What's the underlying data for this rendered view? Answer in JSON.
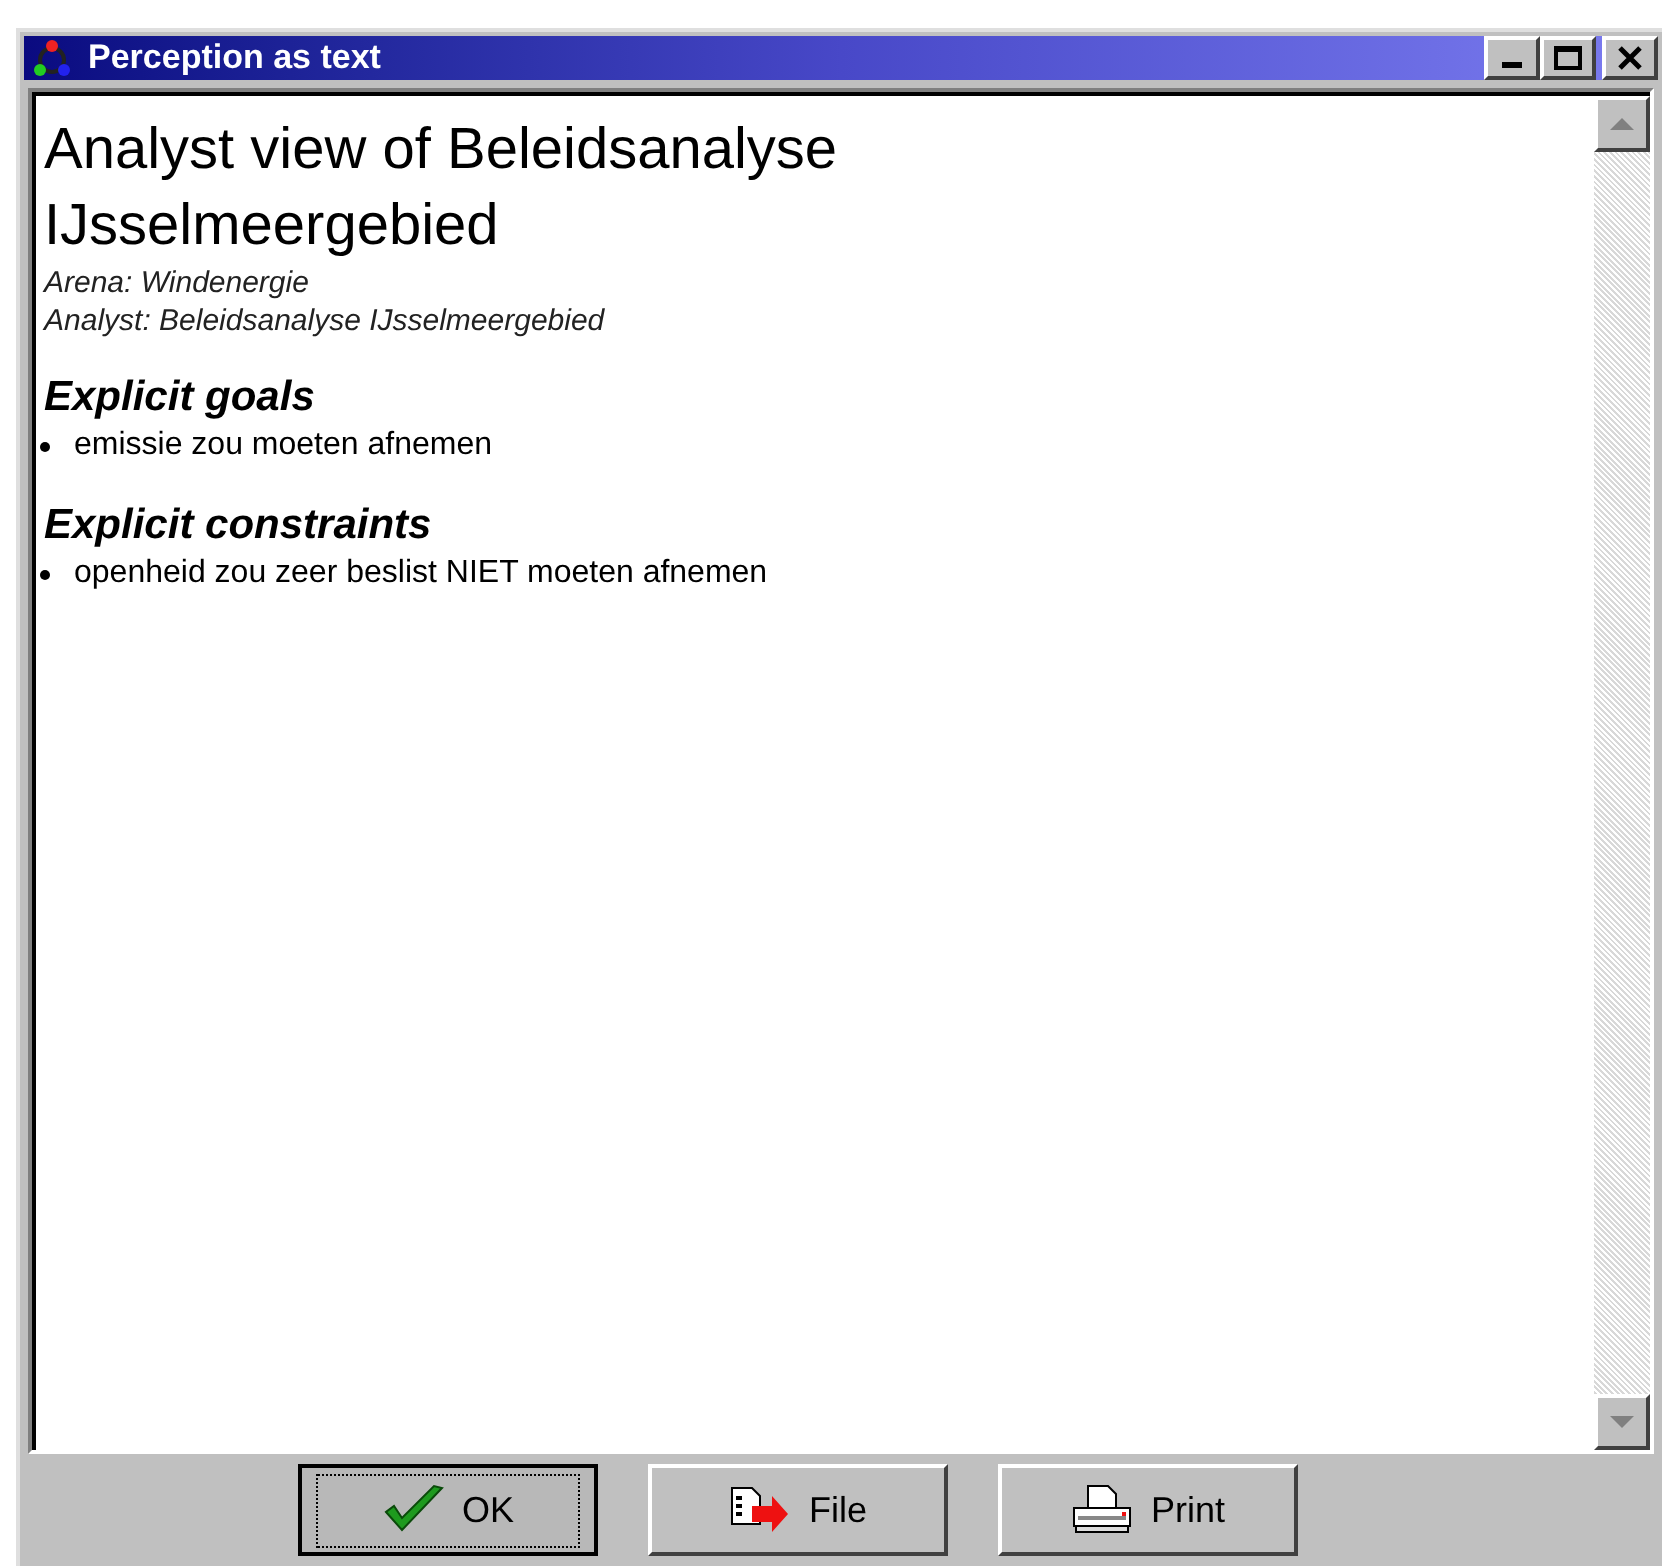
{
  "window": {
    "title": "Perception as text"
  },
  "document": {
    "title": "Analyst view of Beleidsanalyse IJsselmeergebied",
    "meta": [
      "Arena: Windenergie",
      "Analyst: Beleidsanalyse IJsselmeergebied"
    ],
    "sections": [
      {
        "heading": "Explicit goals",
        "items": [
          "emissie zou moeten afnemen"
        ]
      },
      {
        "heading": "Explicit constraints",
        "items": [
          "openheid zou zeer beslist NIET moeten afnemen"
        ]
      }
    ]
  },
  "buttons": [
    {
      "kind": "ok",
      "label": "OK",
      "focused": true
    },
    {
      "kind": "file",
      "label": "File",
      "focused": false
    },
    {
      "kind": "print",
      "label": "Print",
      "focused": false
    }
  ]
}
